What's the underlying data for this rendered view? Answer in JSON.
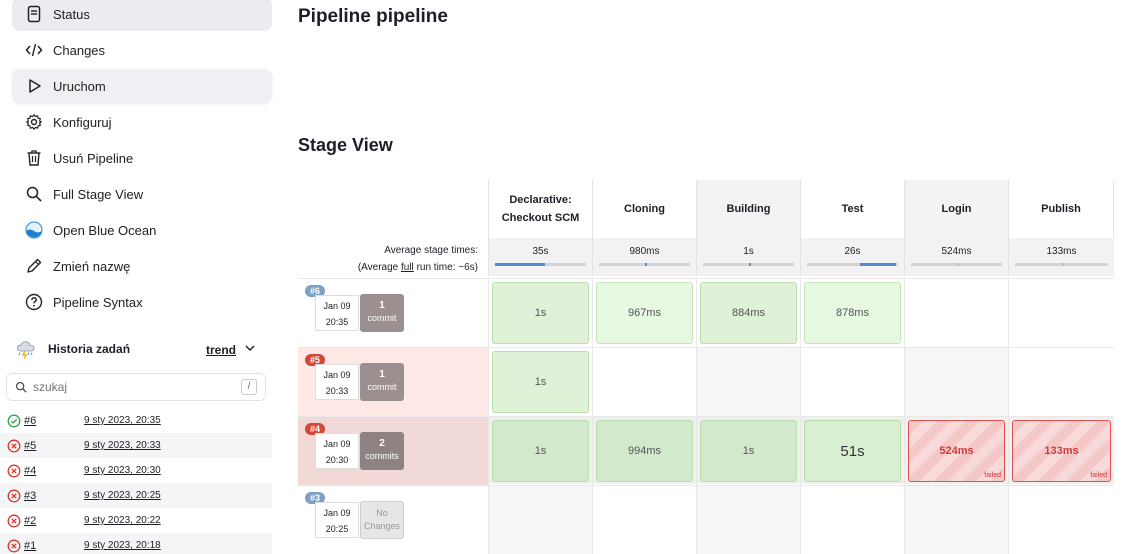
{
  "sidebar": {
    "items": [
      {
        "label": "Status",
        "icon": "document-icon"
      },
      {
        "label": "Changes",
        "icon": "code-icon"
      },
      {
        "label": "Uruchom",
        "icon": "play-icon"
      },
      {
        "label": "Konfiguruj",
        "icon": "gear-icon"
      },
      {
        "label": "Usuń Pipeline",
        "icon": "trash-icon"
      },
      {
        "label": "Full Stage View",
        "icon": "search-icon"
      },
      {
        "label": "Open Blue Ocean",
        "icon": "blue-ocean-icon"
      },
      {
        "label": "Zmień nazwę",
        "icon": "pencil-icon"
      },
      {
        "label": "Pipeline Syntax",
        "icon": "help-icon"
      }
    ],
    "history": {
      "title": "Historia zadań",
      "trend": "trend",
      "search_placeholder": "szukaj",
      "search_shortcut": "/",
      "builds": [
        {
          "num": "#6",
          "date": "9 sty 2023, 20:35",
          "status": "success"
        },
        {
          "num": "#5",
          "date": "9 sty 2023, 20:33",
          "status": "failed"
        },
        {
          "num": "#4",
          "date": "9 sty 2023, 20:30",
          "status": "failed"
        },
        {
          "num": "#3",
          "date": "9 sty 2023, 20:25",
          "status": "failed"
        },
        {
          "num": "#2",
          "date": "9 sty 2023, 20:22",
          "status": "failed"
        },
        {
          "num": "#1",
          "date": "9 sty 2023, 20:18",
          "status": "failed"
        }
      ]
    }
  },
  "main": {
    "title": "Pipeline pipeline",
    "stage_view_title": "Stage View"
  },
  "stage_view": {
    "avg_label_line1": "Average stage times:",
    "avg_label_prefix": "(Average ",
    "avg_label_full": "full",
    "avg_label_suffix": " run time: ~6s)",
    "stages": [
      {
        "name": "Declarative: Checkout SCM",
        "avg": "35s",
        "bar": 0.55
      },
      {
        "name": "Cloning",
        "avg": "980ms",
        "bar": 0.5
      },
      {
        "name": "Building",
        "avg": "1s",
        "bar": 0.5
      },
      {
        "name": "Test",
        "avg": "26s",
        "bar": 0.6
      },
      {
        "name": "Login",
        "avg": "524ms",
        "bar": 0.5
      },
      {
        "name": "Publish",
        "avg": "133ms",
        "bar": 0.5
      }
    ],
    "runs": [
      {
        "badge": "#6",
        "date": "Jan 09",
        "time": "20:35",
        "commit_count": "1",
        "commit_label": "commit",
        "cells": [
          "1s",
          "967ms",
          "884ms",
          "878ms",
          "",
          ""
        ]
      },
      {
        "badge": "#5",
        "date": "Jan 09",
        "time": "20:33",
        "commit_count": "1",
        "commit_label": "commit",
        "cells": [
          "1s",
          "",
          "",
          "",
          "",
          ""
        ]
      },
      {
        "badge": "#4",
        "date": "Jan 09",
        "time": "20:30",
        "commit_count": "2",
        "commit_label": "commits",
        "cells": [
          "1s",
          "994ms",
          "1s",
          "51s",
          "524ms",
          "133ms"
        ],
        "failed_label": "failed"
      },
      {
        "badge": "#3",
        "date": "Jan 09",
        "time": "20:25",
        "commit_count": "No",
        "commit_label": "Changes",
        "cells": [
          "",
          "",
          "",
          "",
          "",
          ""
        ]
      }
    ]
  },
  "colors": {
    "badge_blue": "#7e9fc6",
    "badge_red": "#d24939",
    "commit_grey": "#9b8f8f",
    "row_failed": "#fde8e6",
    "row_failed_dark": "#f0d9d6",
    "success_green": "#28a745",
    "failure_red": "#d9372b"
  }
}
